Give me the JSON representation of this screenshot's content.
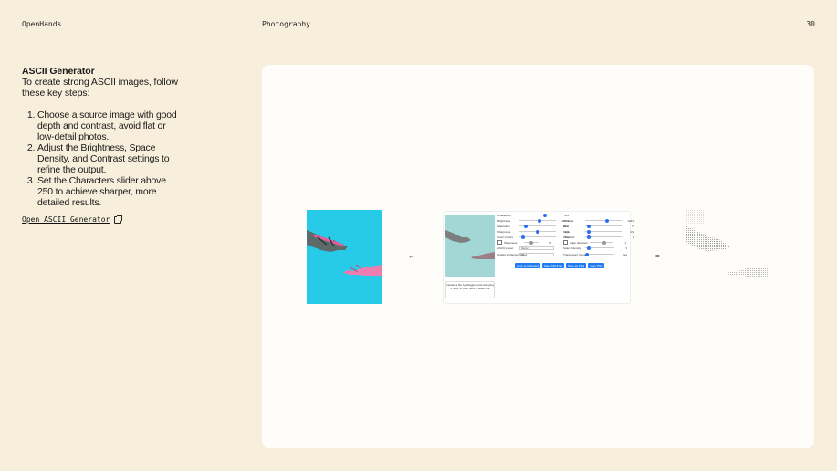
{
  "header": {
    "brand": "OpenHands",
    "section": "Photography",
    "page": "30"
  },
  "left": {
    "title": "ASCII Generator",
    "intro": "To create strong ASCII images, follow these key steps:",
    "steps": [
      "Choose a source image with good depth and contrast, avoid flat or low-detail photos.",
      "Adjust the Brightness, Space Density, and Contrast settings to refine the output.",
      "Set the Characters slider above 250 to achieve sharper, more detailed results."
    ],
    "link": "Open ASCII Generator"
  },
  "figure": {
    "arrow": "←",
    "equals": "=",
    "app": {
      "left_controls": [
        {
          "label": "Characters",
          "value": "451",
          "level": 0.72
        },
        {
          "label": "Brightness",
          "value": "107%",
          "level": 0.55
        },
        {
          "label": "Saturation",
          "value": "22%",
          "level": 0.15
        },
        {
          "label": "Sharpness",
          "value": "0%",
          "level": 0.5
        },
        {
          "label": "Invert Colors",
          "value": "0%",
          "level": 0.05
        }
      ],
      "right_controls": [
        {
          "label": "Contrast",
          "value": "124%",
          "level": 0.6
        },
        {
          "label": "Hue",
          "value": "0°",
          "level": 0.05
        },
        {
          "label": "Sepia",
          "value": "0%",
          "level": 0.05
        },
        {
          "label": "Pixelated",
          "value": "1",
          "level": 0.05
        }
      ],
      "sharpness_label": "Sharpness",
      "sharpness_value": "6",
      "edge_label": "Edge detection",
      "edge_value": "1",
      "space_density_label": "Space Density",
      "space_density_value": "3",
      "ascii_preset_label": "ASCII preset",
      "ascii_preset_value": "Normal",
      "quality_label": "Quality Enhancement",
      "quality_value": "None",
      "transparent_label": "Transparent frame",
      "transparent_value": "Yes",
      "buttons": [
        "Copy to Clipboard",
        "Save ASCII file",
        "Save as PNG",
        "Save PNG"
      ],
      "drop_text": "Upload a file by dragging and dropping it here, or click here to select file"
    },
    "colors": {
      "source_bg": "#27cbe7",
      "thumb_bg": "#a3d7d5",
      "accent": "#1e7bf2"
    }
  }
}
